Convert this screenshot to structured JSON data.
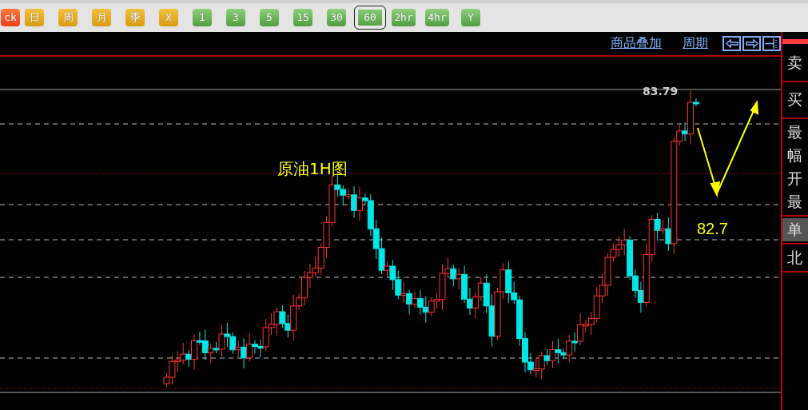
{
  "toolbar": [
    {
      "label": "ck",
      "kind": "red",
      "selected": false
    },
    {
      "label": "日",
      "kind": "orange",
      "selected": false
    },
    {
      "label": "周",
      "kind": "orange",
      "selected": false
    },
    {
      "label": "月",
      "kind": "orange",
      "selected": false
    },
    {
      "label": "季",
      "kind": "orange",
      "selected": false
    },
    {
      "label": "X",
      "kind": "orange",
      "selected": false
    },
    {
      "label": "1",
      "kind": "green",
      "selected": false
    },
    {
      "label": "3",
      "kind": "green",
      "selected": false
    },
    {
      "label": "5",
      "kind": "green",
      "selected": false
    },
    {
      "label": "15",
      "kind": "green",
      "selected": false
    },
    {
      "label": "30",
      "kind": "green",
      "selected": false
    },
    {
      "label": "60",
      "kind": "green",
      "selected": true
    },
    {
      "label": "2hr",
      "kind": "green",
      "selected": false
    },
    {
      "label": "4hr",
      "kind": "green",
      "selected": false
    },
    {
      "label": "Y",
      "kind": "green",
      "selected": false
    }
  ],
  "header_links": [
    "商品叠加",
    "周期"
  ],
  "chart": {
    "price_label": "83.79",
    "title": "原油1H图",
    "target_label": "82.7"
  },
  "side_panel": [
    {
      "items": [
        {
          "label": "卖",
          "selected": false
        }
      ]
    },
    {
      "items": [
        {
          "label": "买",
          "selected": false
        }
      ]
    },
    {
      "items": [
        {
          "label": "最",
          "selected": false
        },
        {
          "label": "幅",
          "selected": false
        },
        {
          "label": "开",
          "selected": false
        },
        {
          "label": "最",
          "selected": false
        }
      ]
    },
    {
      "items": [
        {
          "label": "单",
          "selected": true
        }
      ]
    },
    {
      "items": [
        {
          "label": "北",
          "selected": false
        }
      ]
    }
  ]
}
